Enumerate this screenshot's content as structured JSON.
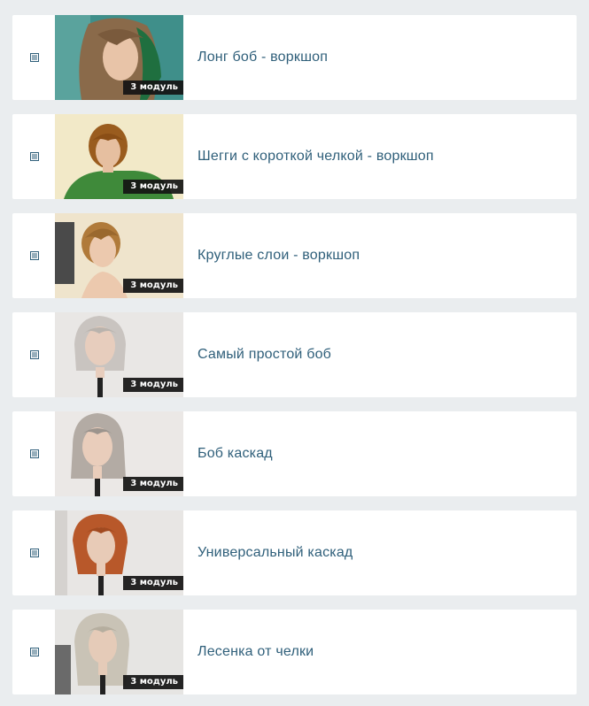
{
  "lessons": [
    {
      "title": "",
      "badge": "",
      "thumb_bg": "#c9a27a"
    },
    {
      "title": "Лонг боб - воркшоп",
      "badge": "3 модуль",
      "thumb_bg": "#3f8f8a",
      "hair": "#8a6a4a",
      "skin": "#e8c4a8",
      "accent": "#1f6f3f"
    },
    {
      "title": "Шегги с короткой челкой - воркшоп",
      "badge": "3 модуль",
      "thumb_bg": "#f2e9c8",
      "hair": "#9a5c1e",
      "skin": "#e6bfa0",
      "accent": "#3f8a3a"
    },
    {
      "title": "Круглые слои - воркшоп",
      "badge": "3 модуль",
      "thumb_bg": "#efe4cc",
      "hair": "#b07a3a",
      "skin": "#ecc9ae",
      "accent": "#3a3a3a"
    },
    {
      "title": "Самый простой боб",
      "badge": "3 модуль",
      "thumb_bg": "#e9e7e5",
      "hair": "#c9c4c0",
      "skin": "#e7cdbd",
      "accent": "#222222"
    },
    {
      "title": "Боб каскад",
      "badge": "3 модуль",
      "thumb_bg": "#ebe8e6",
      "hair": "#b3aba4",
      "skin": "#e9cdbb",
      "accent": "#222222"
    },
    {
      "title": "Универсальный каскад",
      "badge": "3 модуль",
      "thumb_bg": "#e8e6e4",
      "hair": "#b8582a",
      "skin": "#e8cbb7",
      "accent": "#222222"
    },
    {
      "title": "Лесенка от челки",
      "badge": "3 модуль",
      "thumb_bg": "#e6e5e3",
      "hair": "#c9c3b6",
      "skin": "#e5cbb8",
      "accent": "#222222"
    }
  ],
  "colors": {
    "page_bg": "#eaedef",
    "card_bg": "#ffffff",
    "title_text": "#2f5f7a",
    "icon": "#2f5f7a",
    "badge_bg": "#141414"
  },
  "icons": {
    "lesson_icon": "document-lines-icon"
  }
}
